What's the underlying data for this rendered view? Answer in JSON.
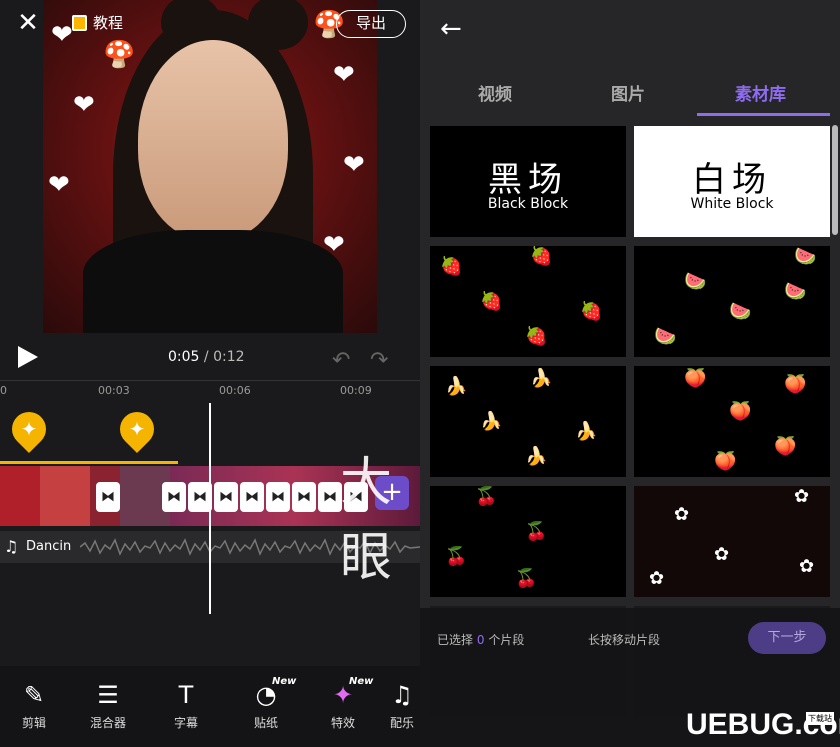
{
  "editor": {
    "tutorial_label": "教程",
    "export_label": "导出",
    "time_current": "0:05",
    "time_separator": "/",
    "time_total": "0:12",
    "ruler_ticks": [
      "0",
      "00:03",
      "00:06",
      "00:09"
    ],
    "audio_name": "Dancin"
  },
  "toolbar": {
    "items": [
      {
        "label": "剪辑",
        "icon": "edit-icon"
      },
      {
        "label": "混合器",
        "icon": "layers-icon"
      },
      {
        "label": "字幕",
        "icon": "text-icon"
      },
      {
        "label": "贴纸",
        "icon": "sticker-icon",
        "badge": "New"
      },
      {
        "label": "特效",
        "icon": "effects-icon",
        "badge": "New"
      },
      {
        "label": "配乐",
        "icon": "music-icon"
      }
    ]
  },
  "library": {
    "tabs": [
      "视频",
      "图片",
      "素材库"
    ],
    "active_tab": "素材库",
    "black_block": {
      "title": "黑场",
      "subtitle": "Black Block"
    },
    "white_block": {
      "title": "白场",
      "subtitle": "White Block"
    },
    "selected_prefix": "已选择",
    "selected_count": "0",
    "selected_suffix": "个片段",
    "hint": "长按移动片段",
    "next_label": "下一步"
  },
  "watermark": {
    "middle": "大眼",
    "logo": "UEBUG.com",
    "logo_sub": "下载站"
  },
  "colors": {
    "accent": "#8e6cf0",
    "sparkle": "#f5b400",
    "add_button": "#6d4cc9"
  }
}
